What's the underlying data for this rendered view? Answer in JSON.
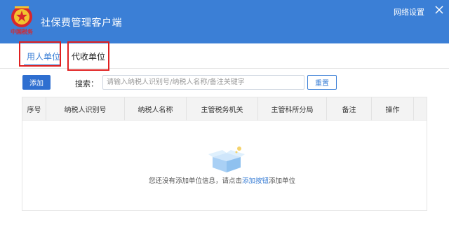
{
  "window": {
    "title": "社保费管理客户端",
    "network_settings": "网络设置",
    "logo_caption": "中国税务"
  },
  "tabs": [
    {
      "label": "用人单位",
      "active": true
    },
    {
      "label": "代收单位",
      "active": false
    }
  ],
  "toolbar": {
    "add_label": "添加",
    "search_label": "搜索：",
    "search_placeholder": "请输入纳税人识别号/纳税人名称/备注关键字",
    "search_value": "",
    "reset_label": "重置"
  },
  "table": {
    "columns": [
      "序号",
      "纳税人识别号",
      "纳税人名称",
      "主管税务机关",
      "主管科所分局",
      "备注",
      "操作"
    ],
    "rows": []
  },
  "empty_state": {
    "prefix": "您还没有添加单位信息，请点击",
    "link": "添加按钮",
    "suffix": "添加单位"
  },
  "colors": {
    "titlebar": "#3b7fd6",
    "accent": "#3b7fd6",
    "highlight": "#e02020"
  },
  "icons": [
    "emblem-logo-icon",
    "close-icon",
    "empty-box-icon"
  ]
}
